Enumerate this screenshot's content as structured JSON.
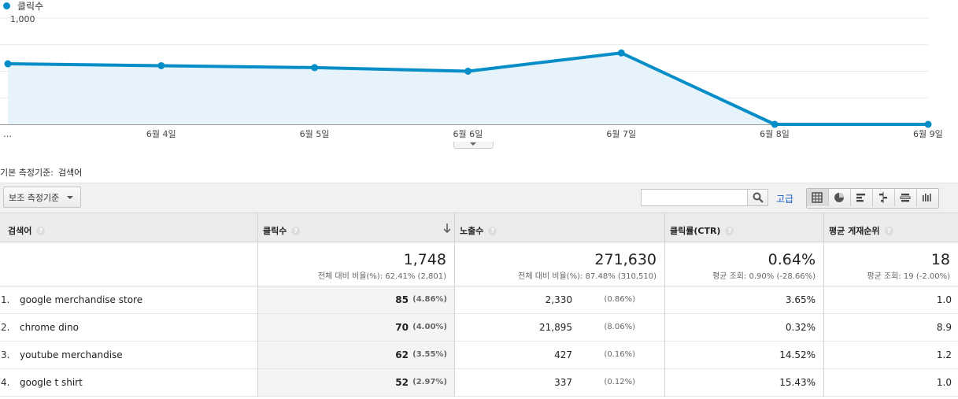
{
  "legend": {
    "label": "클릭수",
    "color": "#058dc7"
  },
  "chart_data": {
    "type": "area",
    "series": [
      {
        "name": "클릭수",
        "values": [
          570,
          552,
          534,
          500,
          672,
          0,
          0
        ]
      }
    ],
    "x_labels": [
      "…",
      "6월 4일",
      "6월 5일",
      "6월 6일",
      "6월 7일",
      "6월 8일",
      "6월 9일"
    ],
    "y_ticks": [
      "1,000",
      "500"
    ],
    "ylim": [
      0,
      1000
    ],
    "grid": true,
    "line_color": "#058dc7",
    "fill_color": "#e6f3fa"
  },
  "dimension": {
    "label": "기본 측정기준:",
    "value": "검색어"
  },
  "toolbar": {
    "secondary_dim": "보조 측정기준",
    "search_placeholder": "",
    "advanced": "고급",
    "views": [
      "grid-icon",
      "pie-icon",
      "bar-icon",
      "comparison-icon",
      "pivot-icon",
      "term-cloud-icon"
    ]
  },
  "table": {
    "headers": {
      "keyword": "검색어",
      "clicks": "클릭수",
      "impressions": "노출수",
      "ctr": "클릭률(CTR)",
      "position": "평균 게재순위"
    },
    "summary": {
      "clicks": {
        "value": "1,748",
        "sub": "전체 대비 비율(%): 62.41% (2,801)"
      },
      "impressions": {
        "value": "271,630",
        "sub": "전체 대비 비율(%): 87.48% (310,510)"
      },
      "ctr": {
        "value": "0.64%",
        "sub": "평균 조회: 0.90% (-28.66%)"
      },
      "position": {
        "value": "18",
        "sub": "평균 조회: 19 (-2.00%)"
      }
    },
    "rows": [
      {
        "num": "1.",
        "keyword": "google merchandise store",
        "clicks": "85",
        "clicks_pct": "(4.86%)",
        "impressions": "2,330",
        "impressions_pct": "(0.86%)",
        "ctr": "3.65%",
        "position": "1.0"
      },
      {
        "num": "2.",
        "keyword": "chrome dino",
        "clicks": "70",
        "clicks_pct": "(4.00%)",
        "impressions": "21,895",
        "impressions_pct": "(8.06%)",
        "ctr": "0.32%",
        "position": "8.9"
      },
      {
        "num": "3.",
        "keyword": "youtube merchandise",
        "clicks": "62",
        "clicks_pct": "(3.55%)",
        "impressions": "427",
        "impressions_pct": "(0.16%)",
        "ctr": "14.52%",
        "position": "1.2"
      },
      {
        "num": "4.",
        "keyword": "google t shirt",
        "clicks": "52",
        "clicks_pct": "(2.97%)",
        "impressions": "337",
        "impressions_pct": "(0.12%)",
        "ctr": "15.43%",
        "position": "1.0"
      }
    ]
  }
}
